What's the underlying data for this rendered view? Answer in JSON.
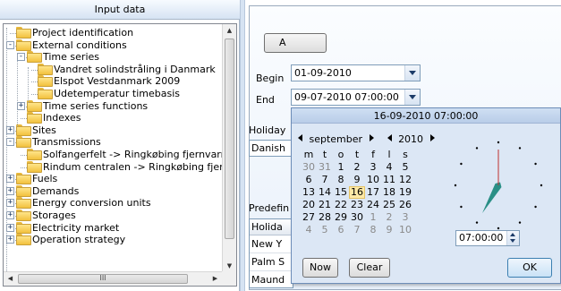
{
  "tree": {
    "header": "Input data",
    "items": [
      {
        "label": "Project identification",
        "level": 0,
        "expander": ""
      },
      {
        "label": "External conditions",
        "level": 0,
        "expander": "−"
      },
      {
        "label": "Time series",
        "level": 1,
        "expander": "−"
      },
      {
        "label": "Vandret solindstråling i Danmark",
        "level": 2,
        "expander": ""
      },
      {
        "label": "Elspot Vestdanmark 2009",
        "level": 2,
        "expander": ""
      },
      {
        "label": "Udetemperatur timebasis",
        "level": 2,
        "expander": ""
      },
      {
        "label": "Time series functions",
        "level": 1,
        "expander": "+"
      },
      {
        "label": "Indexes",
        "level": 1,
        "expander": ""
      },
      {
        "label": "Sites",
        "level": 0,
        "expander": "+"
      },
      {
        "label": "Transmissions",
        "level": 0,
        "expander": "−"
      },
      {
        "label": "Solfangerfelt -> Ringkøbing fjernvarm",
        "level": 1,
        "expander": ""
      },
      {
        "label": "Rindum centralen -> Ringkøbing fjen",
        "level": 1,
        "expander": ""
      },
      {
        "label": "Fuels",
        "level": 0,
        "expander": "+"
      },
      {
        "label": "Demands",
        "level": 0,
        "expander": "+"
      },
      {
        "label": "Energy conversion units",
        "level": 0,
        "expander": "+"
      },
      {
        "label": "Storages",
        "level": 0,
        "expander": "+"
      },
      {
        "label": "Electricity market",
        "level": 0,
        "expander": "+"
      },
      {
        "label": "Operation strategy",
        "level": 0,
        "expander": "+"
      }
    ],
    "hscroll_grip": "III"
  },
  "form": {
    "a_button": "A",
    "begin_label": "Begin",
    "begin_value": "01-09-2010",
    "end_label": "End",
    "end_value": "09-07-2010 07:00:00",
    "holiday_label": "Holiday",
    "holiday_value": "Danish",
    "predef_label": "Predefin",
    "table_header": "Holida",
    "table_rows": [
      "New Y",
      "Palm S",
      "Maund"
    ]
  },
  "popup": {
    "title": "16-09-2010 07:00:00",
    "month": "september",
    "year": "2010",
    "weekdays": [
      "m",
      "t",
      "o",
      "t",
      "f",
      "l",
      "s"
    ],
    "weeks": [
      [
        {
          "d": "30",
          "o": true
        },
        {
          "d": "31",
          "o": true
        },
        {
          "d": "1"
        },
        {
          "d": "2"
        },
        {
          "d": "3"
        },
        {
          "d": "4"
        },
        {
          "d": "5"
        }
      ],
      [
        {
          "d": "6"
        },
        {
          "d": "7"
        },
        {
          "d": "8"
        },
        {
          "d": "9"
        },
        {
          "d": "10"
        },
        {
          "d": "11"
        },
        {
          "d": "12"
        }
      ],
      [
        {
          "d": "13"
        },
        {
          "d": "14"
        },
        {
          "d": "15"
        },
        {
          "d": "16",
          "sel": true
        },
        {
          "d": "17"
        },
        {
          "d": "18"
        },
        {
          "d": "19"
        }
      ],
      [
        {
          "d": "20"
        },
        {
          "d": "21"
        },
        {
          "d": "22"
        },
        {
          "d": "23"
        },
        {
          "d": "24"
        },
        {
          "d": "25"
        },
        {
          "d": "26"
        }
      ],
      [
        {
          "d": "27"
        },
        {
          "d": "28"
        },
        {
          "d": "29"
        },
        {
          "d": "30"
        },
        {
          "d": "1",
          "o": true
        },
        {
          "d": "2",
          "o": true
        },
        {
          "d": "3",
          "o": true
        }
      ],
      [
        {
          "d": "4",
          "o": true
        },
        {
          "d": "5",
          "o": true
        },
        {
          "d": "6",
          "o": true
        },
        {
          "d": "7",
          "o": true
        },
        {
          "d": "8",
          "o": true
        },
        {
          "d": "9",
          "o": true
        },
        {
          "d": "10",
          "o": true
        }
      ]
    ],
    "time_value": "07:00:00",
    "clock": {
      "hour": 7,
      "minute": 0
    },
    "now_label": "Now",
    "clear_label": "Clear",
    "ok_label": "OK"
  },
  "colors": {
    "selected_day_bg": "#fde9a6",
    "clock_hand": "#2a8f86",
    "clock_minute_hand": "#c03030",
    "popup_bg": "#dce7f5"
  }
}
